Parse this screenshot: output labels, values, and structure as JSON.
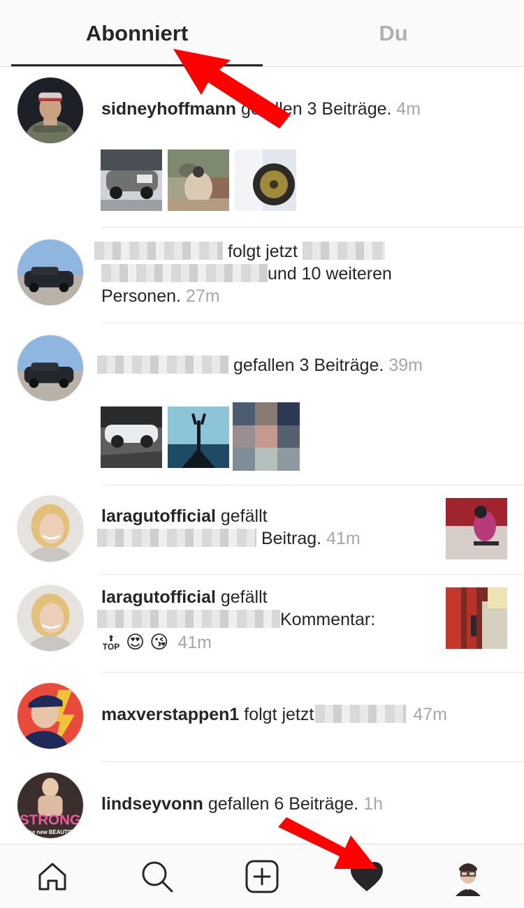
{
  "tabs": {
    "following": "Abonniert",
    "you": "Du"
  },
  "notifications": [
    {
      "username": "sidneyhoffmann",
      "action": " gefallen 3 Beiträge. ",
      "time": "4m"
    },
    {
      "action_1": "folgt jetzt",
      "action_2": "und 10 weiteren",
      "action_3": "Personen. ",
      "time": "27m"
    },
    {
      "action": " gefallen 3 Beiträge. ",
      "time": "39m"
    },
    {
      "username": "laragutofficial",
      "action": " gefällt",
      "action_2": "Beitrag. ",
      "time": "41m"
    },
    {
      "username": "laragutofficial",
      "action": " gefällt",
      "action_2": "Kommentar:",
      "emoji_top_label": "TOP",
      "emojis": "😍 😘",
      "time": "41m"
    },
    {
      "username": "maxverstappen1",
      "action": " folgt jetzt",
      "time": "47m"
    },
    {
      "username": "lindseyvonn",
      "action": " gefallen 6 Beiträge. ",
      "time": "1h",
      "avatar_text_1": "STRONG",
      "avatar_text_2": "is the new BEAUTIFUL"
    }
  ],
  "bottom_nav": [
    {
      "icon": "home-icon"
    },
    {
      "icon": "search-icon"
    },
    {
      "icon": "add-post-icon"
    },
    {
      "icon": "heart-icon",
      "active": true
    },
    {
      "icon": "profile-avatar"
    }
  ],
  "colors": {
    "text": "#262626",
    "muted": "#a7a7a7",
    "inactive_tab": "#b0b0b0",
    "annotation_arrow": "#ff0000"
  }
}
